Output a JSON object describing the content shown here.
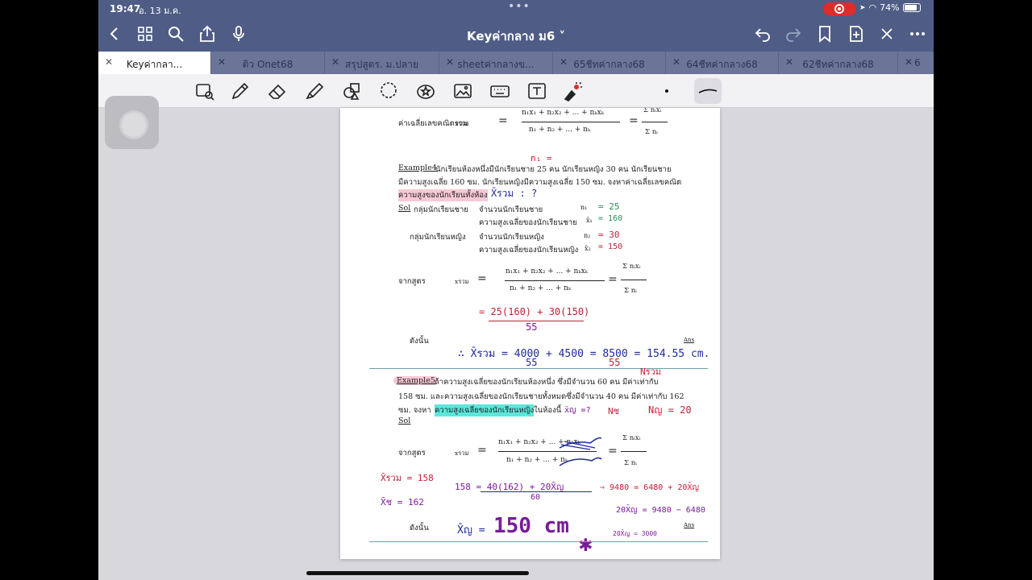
{
  "status": {
    "time": "19:47",
    "date": "อ. 13 ม.ค.",
    "battery": "74%"
  },
  "header": {
    "title": "Keyค่ากลาง ม6 ˅"
  },
  "tabs": [
    {
      "label": "Keyค่ากลา..."
    },
    {
      "label": "ติว Onet68"
    },
    {
      "label": "สรุปสูตร. ม.ปลาย"
    },
    {
      "label": "sheetค่ากลางข..."
    },
    {
      "label": "65ชีทค่ากลาง68"
    },
    {
      "label": "64ชีทค่ากลาง68"
    },
    {
      "label": "62ชีทค่ากลาง68"
    },
    {
      "label": "6"
    }
  ],
  "doc": {
    "combined_mean_label": "ค่าเฉลี่ยเลขคณิตรวม",
    "xbar_sub": "xรวม",
    "numerator1": "n₁x₁ + n₂x₂ + ... + nₖxₖ",
    "denominator1": "n₁ + n₂ + ... + nₖ",
    "sum_num": "Σ nᵢxᵢ",
    "sum_den": "Σ nᵢ",
    "hw_n1": "n₁ =",
    "ex4_title": "Example4",
    "ex4_line1": "นักเรียนห้องหนึ่งมีนักเรียนชาย 25 คน นักเรียนหญิง 30 คน นักเรียนชาย",
    "ex4_line2": "มีความสูงเฉลี่ย 160 ซม. นักเรียนหญิงมีความสูงเฉลี่ย 150 ซม. จงหาค่าเฉลี่ยเลขคณิต",
    "ex4_line3": "ความสูงของนักเรียนทั้งห้อง",
    "ex4_hw_q": "X̄รวม : ?",
    "sol_label": "Sol",
    "g1_label": "กลุ่มนักเรียนชาย",
    "g1_count": "จำนวนนักเรียนชาย",
    "g1_count_sym": "n₁",
    "g1_count_val": "= 25",
    "g1_mean": "ความสูงเฉลี่ยของนักเรียนชาย",
    "g1_mean_sym": "x̄₁",
    "g1_mean_val": "= 160",
    "g2_label": "กลุ่มนักเรียนหญิง",
    "g2_count": "จำนวนนักเรียนหญิง",
    "g2_count_sym": "n₂",
    "g2_count_val": "= 30",
    "g2_mean": "ความสูงเฉลี่ยของนักเรียนหญิง",
    "g2_mean_sym": "x̄₂",
    "g2_mean_val": "= 150",
    "from_formula": "จากสูตร",
    "hw_step1_num": "= 25(160) + 30(150)",
    "hw_step1_den": "55",
    "therefore": "ดังนั้น",
    "hw_result": "∴ X̄รวม = 4000 + 4500 = 8500 = 154.55 cm.",
    "hw_result_den1": "55",
    "hw_result_den2": "55",
    "ans": "Ans",
    "ex5_title": "Example5",
    "ex5_line1": "ถ้าความสูงเฉลี่ยของนักเรียนห้องหนึ่ง ซึ่งมีจำนวน 60 คน มีค่าเท่ากับ",
    "ex5_line2": "158 ซม. และความสูงเฉลี่ยของนักเรียนชายทั้งหมดซึ่งมีจำนวน 40 คน มีค่าเท่ากับ 162",
    "ex5_line3a": "ซม. จงหา",
    "ex5_line3b": "ความสูงเฉลี่ยของนักเรียนหญิง",
    "ex5_line3c": "ในห้องนี้",
    "hw_xq": "x̄ญ =?",
    "hw_nsum": "Nรวม",
    "hw_nb": "Nช",
    "hw_ng": "Nญ = 20",
    "sol2": "Sol",
    "hw_left1": "X̄รวม = 158",
    "hw_left2": "X̄ช = 162",
    "hw_eq1": "158 = 40(162) + 20X̄ญ",
    "hw_eq1_den": "60",
    "hw_eq2": "⇒ 9480 = 6480 + 20X̄ญ",
    "hw_eq3": "20X̄ญ = 9480 − 6480",
    "hw_eq4": "20X̄ญ = 3000",
    "hw_final_sym": "X̄ญ =",
    "hw_final": "150 cm",
    "hw_star": "✱"
  }
}
